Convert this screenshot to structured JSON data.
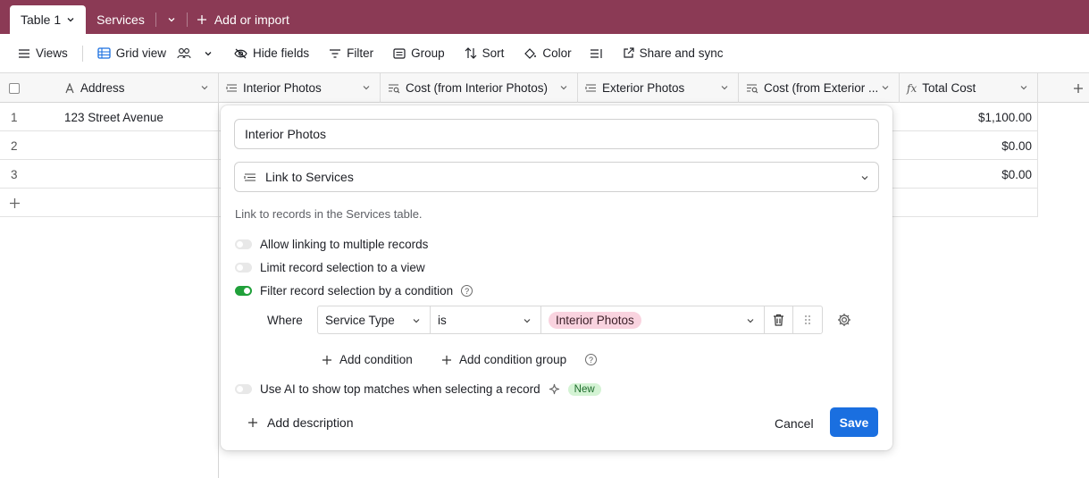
{
  "tabs": {
    "active": "Table 1",
    "other": "Services",
    "add": "Add or import"
  },
  "toolbar": {
    "views": "Views",
    "grid_view": "Grid view",
    "hide_fields": "Hide fields",
    "filter": "Filter",
    "group": "Group",
    "sort": "Sort",
    "color": "Color",
    "share": "Share and sync"
  },
  "columns": [
    {
      "label": "Address",
      "icon": "text-a-icon"
    },
    {
      "label": "Interior Photos",
      "icon": "link-icon"
    },
    {
      "label": "Cost (from Interior Photos)",
      "icon": "lookup-icon"
    },
    {
      "label": "Exterior Photos",
      "icon": "link-icon"
    },
    {
      "label": "Cost (from Exterior ...",
      "icon": "lookup-icon"
    },
    {
      "label": "Total Cost",
      "icon": "formula-icon"
    }
  ],
  "rows": [
    {
      "num": "1",
      "address": "123 Street Avenue",
      "total": "$1,100.00"
    },
    {
      "num": "2",
      "address": "",
      "total": "$0.00"
    },
    {
      "num": "3",
      "address": "",
      "total": "$0.00"
    }
  ],
  "modal": {
    "field_name": "Interior Photos",
    "field_type": "Link to Services",
    "description": "Link to records in the Services table.",
    "options": {
      "multiple": "Allow linking to multiple records",
      "limit_view": "Limit record selection to a view",
      "filter_condition": "Filter record selection by a condition",
      "ai": "Use AI to show top matches when selecting a record"
    },
    "toggles": {
      "multiple": false,
      "limit_view": false,
      "filter_condition": true,
      "ai": false
    },
    "condition": {
      "where": "Where",
      "field": "Service Type",
      "operator": "is",
      "value": "Interior Photos"
    },
    "add_condition": "Add condition",
    "add_condition_group": "Add condition group",
    "new_badge": "New",
    "add_description": "Add description",
    "cancel": "Cancel",
    "save": "Save"
  },
  "colors": {
    "tabbar": "#8b3a55",
    "save": "#1a6fe0",
    "toggle_on": "#20a03a",
    "pill": "#f9d3df"
  }
}
